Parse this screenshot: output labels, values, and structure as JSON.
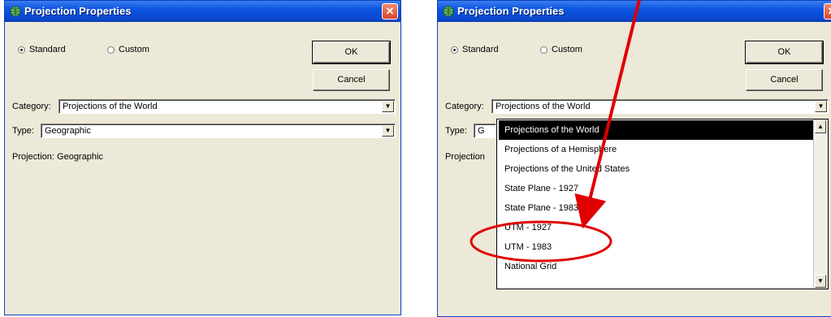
{
  "left_dialog": {
    "title": "Projection Properties",
    "close_glyph": "✕",
    "radio_standard": "Standard",
    "radio_custom": "Custom",
    "ok_label": "OK",
    "cancel_label": "Cancel",
    "category_label": "Category:",
    "category_value": "Projections of the World",
    "type_label": "Type:",
    "type_value": "Geographic",
    "projection_text": "Projection:  Geographic"
  },
  "right_dialog": {
    "title": "Projection Properties",
    "close_glyph": "✕",
    "radio_standard": "Standard",
    "radio_custom": "Custom",
    "ok_label": "OK",
    "cancel_label": "Cancel",
    "category_label": "Category:",
    "category_value": "Projections of the World",
    "type_label": "Type:",
    "type_value_partial": "G",
    "projection_partial": "Projection",
    "dropdown_items": [
      "Projections of the World",
      "Projections of a Hemisphere",
      "Projections of the United States",
      "State Plane - 1927",
      "State Plane - 1983",
      "UTM - 1927",
      "UTM - 1983",
      "National Grid"
    ],
    "selected_index": 0,
    "highlighted_item": "UTM - 1983"
  },
  "annotation": {
    "arrow_color": "#e00000",
    "ellipse_color": "#e00000"
  },
  "icons": [
    "globe-icon",
    "close-icon",
    "dropdown-arrow-icon",
    "scroll-up-icon",
    "scroll-down-icon"
  ]
}
